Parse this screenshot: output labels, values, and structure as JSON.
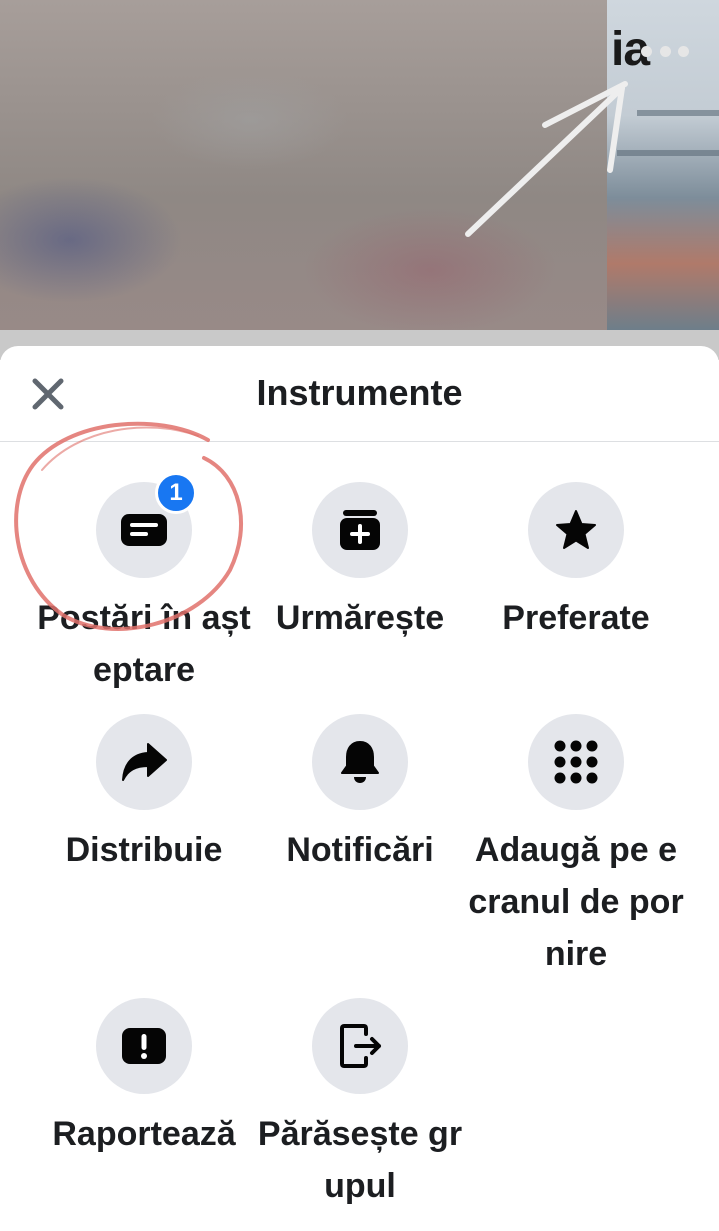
{
  "header": {
    "title_fragment": "ia"
  },
  "sheet": {
    "title": "Instrumente",
    "close_label": "Închide"
  },
  "tools": [
    {
      "label": "Postări în așteptare",
      "icon": "pending-posts-icon",
      "badge": "1"
    },
    {
      "label": "Urmărește",
      "icon": "follow-icon"
    },
    {
      "label": "Preferate",
      "icon": "star-icon"
    },
    {
      "label": "Distribuie",
      "icon": "share-icon"
    },
    {
      "label": "Notificări",
      "icon": "bell-icon"
    },
    {
      "label": "Adaugă pe ecranul de pornire",
      "icon": "grid-icon"
    },
    {
      "label": "Raportează",
      "icon": "report-icon"
    },
    {
      "label": "Părăsește grupul",
      "icon": "leave-group-icon"
    }
  ],
  "colors": {
    "badge": "#1877f2",
    "icon_bg": "#e4e6eb",
    "annotation": "#e0716b"
  }
}
